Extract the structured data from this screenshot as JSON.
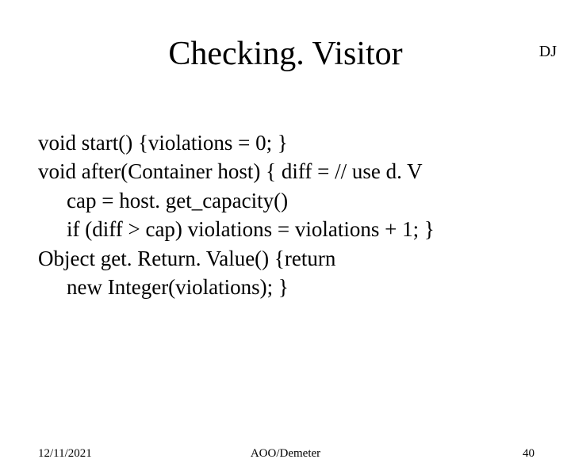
{
  "tag": "DJ",
  "title": "Checking. Visitor",
  "code": {
    "l1": "void start() {violations = 0; }",
    "l2": "void after(Container host) { diff = // use d. V",
    "l3": "cap = host. get_capacity()",
    "l4": "if (diff > cap) violations = violations + 1; }",
    "l5": "Object get. Return. Value() {return",
    "l6": "new Integer(violations); }"
  },
  "footer": {
    "date": "12/11/2021",
    "center": "AOO/Demeter",
    "page": "40"
  }
}
